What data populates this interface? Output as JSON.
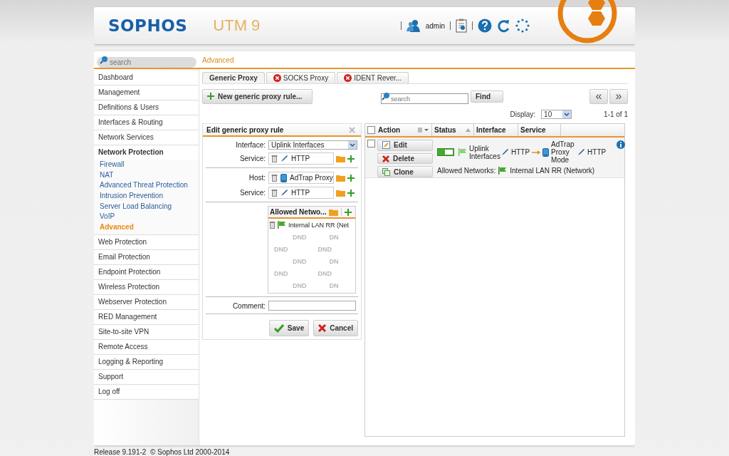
{
  "header": {
    "logo": "SOPHOS",
    "product": "UTM 9",
    "user": "admin"
  },
  "sidebar": {
    "search_placeholder": "search",
    "items": [
      {
        "label": "Dashboard",
        "selected": false
      },
      {
        "label": "Management",
        "selected": false
      },
      {
        "label": "Definitions & Users",
        "selected": false
      },
      {
        "label": "Interfaces & Routing",
        "selected": false
      },
      {
        "label": "Network Services",
        "selected": false
      },
      {
        "label": "Network Protection",
        "selected": false,
        "expanded": true,
        "children": [
          {
            "label": "Firewall",
            "selected": false
          },
          {
            "label": "NAT",
            "selected": false
          },
          {
            "label": "Advanced Threat Protection",
            "selected": false
          },
          {
            "label": "Intrusion Prevention",
            "selected": false
          },
          {
            "label": "Server Load Balancing",
            "selected": false
          },
          {
            "label": "VoIP",
            "selected": false
          },
          {
            "label": "Advanced",
            "selected": true
          }
        ]
      },
      {
        "label": "Web Protection",
        "selected": false
      },
      {
        "label": "Email Protection",
        "selected": false
      },
      {
        "label": "Endpoint Protection",
        "selected": false
      },
      {
        "label": "Wireless Protection",
        "selected": false
      },
      {
        "label": "Webserver Protection",
        "selected": false
      },
      {
        "label": "RED Management",
        "selected": false
      },
      {
        "label": "Site-to-site VPN",
        "selected": false
      },
      {
        "label": "Remote Access",
        "selected": false
      },
      {
        "label": "Logging & Reporting",
        "selected": false
      },
      {
        "label": "Support",
        "selected": false
      },
      {
        "label": "Log off",
        "selected": false
      }
    ]
  },
  "breadcrumb": "Advanced",
  "tabs": [
    {
      "label": "Generic Proxy",
      "selected": true,
      "error": false
    },
    {
      "label": "SOCKS Proxy",
      "selected": false,
      "error": true
    },
    {
      "label": "IDENT Rever...",
      "selected": false,
      "error": true
    }
  ],
  "new_button": "New generic proxy rule...",
  "search": {
    "placeholder": "search",
    "button": "Find"
  },
  "pager": {
    "prev": "«",
    "next": "»",
    "display_label": "Display:",
    "display_value": "10",
    "count": "1-1 of 1"
  },
  "edit_panel": {
    "title": "Edit generic proxy rule",
    "sections": [
      [
        {
          "kind": "select",
          "label": "Interface:",
          "value": "Uplink Interfaces"
        },
        {
          "kind": "object",
          "label": "Service:",
          "object": {
            "kind": "service",
            "label": "HTTP"
          }
        }
      ],
      [
        {
          "kind": "object",
          "label": "Host:",
          "object": {
            "kind": "host",
            "label": "AdTrap Proxy"
          }
        },
        {
          "kind": "object",
          "label": "Service:",
          "object": {
            "kind": "service",
            "label": "HTTP"
          }
        }
      ]
    ],
    "allowed_networks": {
      "title": "Allowed Netwo...",
      "items": [
        {
          "kind": "network",
          "label": "Internal LAN RR (Net"
        }
      ],
      "dnd_rows": [
        [
          "DND",
          "DN"
        ],
        [
          "DND",
          "DND"
        ],
        [
          "DND",
          "DN"
        ],
        [
          "DND",
          "DND"
        ],
        [
          "DND",
          "DN"
        ]
      ]
    },
    "comment": {
      "label": "Comment:"
    },
    "save": "Save",
    "cancel": "Cancel"
  },
  "table": {
    "header_checked": false,
    "columns": [
      "Action",
      "Status",
      "Interface",
      "Service"
    ],
    "rows": [
      {
        "checked": false,
        "actions": [
          "Edit",
          "Delete",
          "Clone"
        ],
        "enabled": true,
        "interface": {
          "kind": "interface",
          "label": "Uplink Interfaces"
        },
        "service": {
          "kind": "service",
          "label": "HTTP"
        },
        "host": {
          "kind": "host",
          "label": "AdTrap Proxy Mode"
        },
        "host_service": {
          "kind": "service",
          "label": "HTTP"
        },
        "allowed_label": "Allowed Networks:",
        "allowed": {
          "kind": "network",
          "label": "Internal LAN RR (Network)"
        }
      }
    ]
  },
  "footer": "Release 9.191-2  © Sophos Ltd 2000-2014"
}
